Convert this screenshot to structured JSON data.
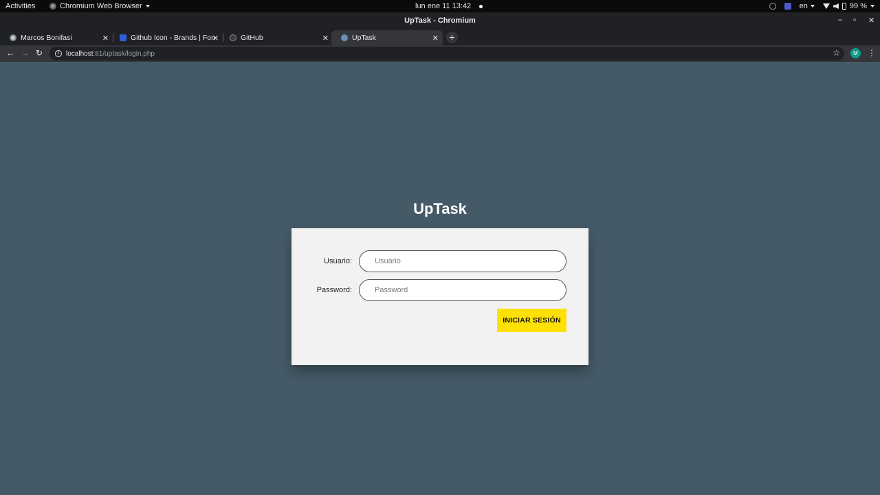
{
  "os": {
    "activities": "Activities",
    "app_name": "Chromium Web Browser",
    "clock": "lun ene 11  13:42",
    "language": "en",
    "battery": "99 %"
  },
  "window": {
    "title": "UpTask - Chromium",
    "minimize": "–",
    "maximize": "▫",
    "close": "✕"
  },
  "tabs": [
    {
      "title": "Marcos Bonifasi",
      "favicon": "globe-icon"
    },
    {
      "title": "Github Icon - Brands | Fon",
      "favicon": "fontawesome-flag-icon"
    },
    {
      "title": "GitHub",
      "favicon": "github-icon"
    },
    {
      "title": "UpTask",
      "favicon": "uptask-icon",
      "active": true
    }
  ],
  "toolbar": {
    "url_host": "localhost",
    "url_path": ":81/uptask/login.php",
    "profile_initial": "M"
  },
  "page": {
    "title": "UpTask",
    "form": {
      "user_label": "Usuario:",
      "user_placeholder": "Usuario",
      "password_label": "Password:",
      "password_placeholder": "Password",
      "submit_label": "INICIAR SESIÓN"
    }
  },
  "colors": {
    "page_background": "#455a67",
    "card_background": "#f2f2f2",
    "button_accent": "#fde006"
  }
}
